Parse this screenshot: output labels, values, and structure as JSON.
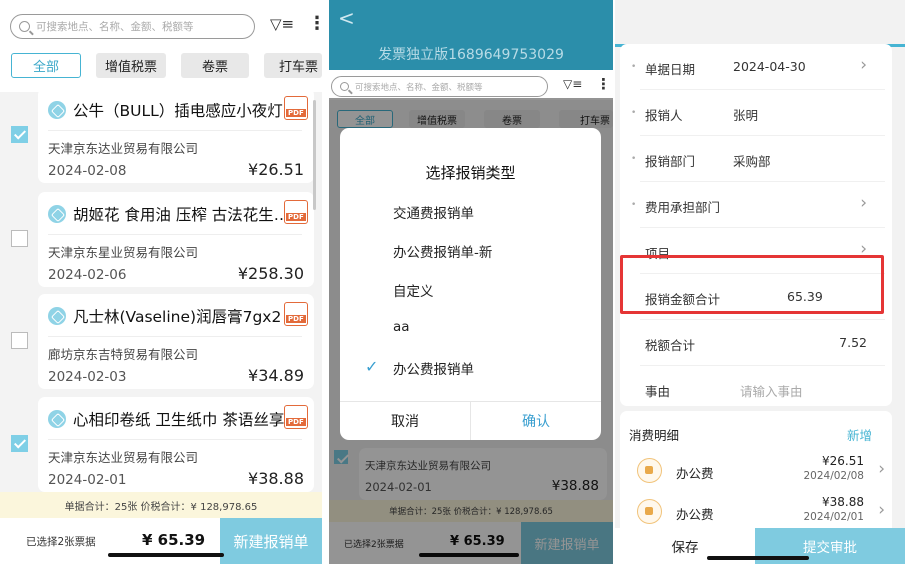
{
  "left": {
    "search_placeholder": "可搜索地点、名称、金额、税额等",
    "tabs": [
      "全部",
      "增值税票",
      "卷票",
      "打车票"
    ],
    "invoices": [
      {
        "title": "公牛（BULL）插电感应小夜灯…",
        "company": "天津京东达业贸易有限公司",
        "date": "2024-02-08",
        "amount": "¥26.51",
        "checked": true
      },
      {
        "title": "胡姬花 食用油 压榨 古法花生…",
        "company": "天津京东星业贸易有限公司",
        "date": "2024-02-06",
        "amount": "¥258.30",
        "checked": false
      },
      {
        "title": "凡士林(Vaseline)润唇膏7gx2 …",
        "company": "廊坊京东吉特贸易有限公司",
        "date": "2024-02-03",
        "amount": "¥34.89",
        "checked": false
      },
      {
        "title": "心相印卷纸 卫生纸巾 茶语丝享…",
        "company": "天津京东达业贸易有限公司",
        "date": "2024-02-01",
        "amount": "¥38.88",
        "checked": true
      }
    ],
    "pdf_label": "PDF",
    "summary": "单据合计：25张    价税合计：¥ 128,978.65",
    "selected_text": "已选择2张票据",
    "total": "¥ 65.39",
    "new_button": "新建报销单"
  },
  "middle": {
    "back": "<",
    "title": "发票独立版1689649753029",
    "search_placeholder": "可搜索地点、名称、金额、税额等",
    "tabs": [
      "全部",
      "增值税票",
      "卷票",
      "打车票"
    ],
    "dialog": {
      "title": "选择报销类型",
      "options": [
        "交通费报销单",
        "办公费报销单-新",
        "自定义",
        "aa",
        "办公费报销单"
      ],
      "selected_index": 4,
      "cancel": "取消",
      "confirm": "确认"
    },
    "bg_company": "天津京东达业贸易有限公司",
    "bg_date": "2024-02-01",
    "bg_amount": "¥38.88",
    "summary": "单据合计：25张    价税合计：¥ 128,978.65",
    "selected_text": "已选择2张票据",
    "total": "¥ 65.39",
    "new_button": "新建报销单"
  },
  "right": {
    "fields": [
      {
        "label": "单据日期",
        "value": "2024-04-30",
        "required": true,
        "chevron": true
      },
      {
        "label": "报销人",
        "value": "张明",
        "required": true,
        "chevron": false
      },
      {
        "label": "报销部门",
        "value": "采购部",
        "required": true,
        "chevron": false
      },
      {
        "label": "费用承担部门",
        "value": "",
        "required": true,
        "chevron": true
      },
      {
        "label": "项目",
        "value": "",
        "required": false,
        "chevron": true
      },
      {
        "label": "报销金额合计",
        "value": "65.39",
        "required": false,
        "chevron": false
      },
      {
        "label": "税额合计",
        "value": "7.52",
        "required": false,
        "chevron": false
      },
      {
        "label": "事由",
        "value": "请输入事由",
        "required": false,
        "chevron": false
      }
    ],
    "details_title": "消费明细",
    "add_label": "新增",
    "details": [
      {
        "name": "办公费",
        "amount": "¥26.51",
        "date": "2024/02/08"
      },
      {
        "name": "办公费",
        "amount": "¥38.88",
        "date": "2024/02/01"
      }
    ],
    "save": "保存",
    "submit": "提交审批"
  }
}
